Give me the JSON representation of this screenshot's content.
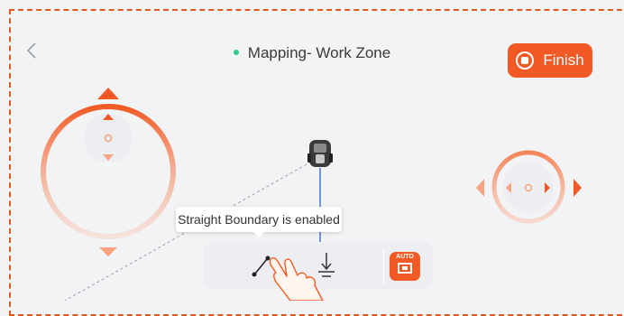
{
  "header": {
    "title": "Mapping- Work Zone",
    "status_color": "#2ecc8f",
    "finish_label": "Finish",
    "back_icon": "chevron-left-icon"
  },
  "tooltip": {
    "text": "Straight Boundary is enabled"
  },
  "toolbar": {
    "straight_boundary_icon": "line-tool-icon",
    "record_point_icon": "record-point-icon",
    "auto_label": "AUTO"
  },
  "colors": {
    "accent": "#f15a24",
    "frame_border": "#e0571f",
    "boundary_line": "#6f95d8"
  }
}
